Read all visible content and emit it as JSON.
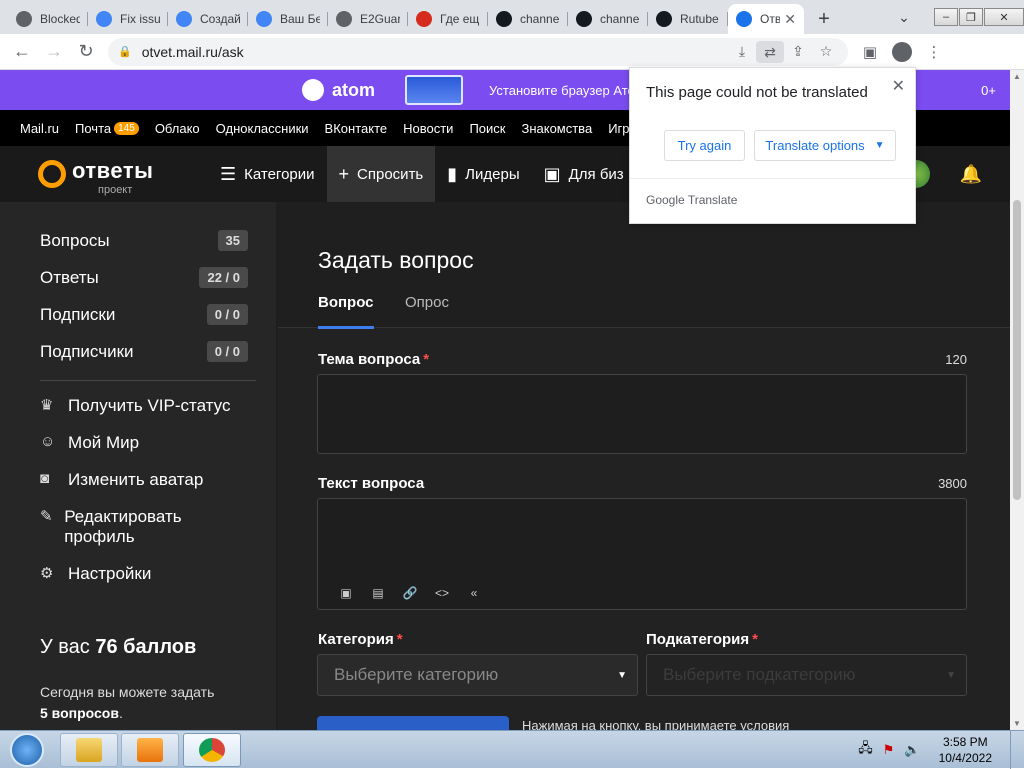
{
  "browser": {
    "tabs": [
      {
        "label": "Blocked",
        "icon": "globe-icon",
        "color": "#5f6368"
      },
      {
        "label": "Fix issu",
        "icon": "google-icon",
        "color": "#4285f4"
      },
      {
        "label": "Создай",
        "icon": "google-icon",
        "color": "#4285f4"
      },
      {
        "label": "Ваш Бе",
        "icon": "google-icon",
        "color": "#4285f4"
      },
      {
        "label": "E2Guar",
        "icon": "globe-icon",
        "color": "#5f6368"
      },
      {
        "label": "Где ещ",
        "icon": "swiss-flag-icon",
        "color": "#d52b1e"
      },
      {
        "label": "channe",
        "icon": "rutube-icon",
        "color": "#14191f"
      },
      {
        "label": "channe",
        "icon": "rutube-icon",
        "color": "#14191f"
      },
      {
        "label": "Rutube",
        "icon": "rutube-icon",
        "color": "#14191f"
      },
      {
        "label": "Отв",
        "icon": "question-icon",
        "color": "#1a73e8",
        "active": true
      }
    ],
    "new_tab": "+",
    "url": "otvet.mail.ru/ask"
  },
  "promo": {
    "brand": "atom",
    "text": "Установите браузер Ато",
    "cut_text": "ть",
    "age": "0+"
  },
  "mailbar": {
    "items": [
      "Mail.ru",
      "Почта",
      "Облако",
      "Одноклассники",
      "ВКонтакте",
      "Новости",
      "Поиск",
      "Знакомства",
      "Игр"
    ],
    "mail_badge": "145"
  },
  "header": {
    "logo": "ответы",
    "logo_sub": "проект",
    "nav": [
      {
        "label": "Категории",
        "icon": "list-icon"
      },
      {
        "label": "Спросить",
        "icon": "plus-icon",
        "active": true
      },
      {
        "label": "Лидеры",
        "icon": "chart-icon"
      },
      {
        "label": "Для биз",
        "icon": "briefcase-icon"
      }
    ]
  },
  "sidebar": {
    "stats": [
      {
        "label": "Вопросы",
        "count": "35"
      },
      {
        "label": "Ответы",
        "count": "22 / 0"
      },
      {
        "label": "Подписки",
        "count": "0 / 0"
      },
      {
        "label": "Подписчики",
        "count": "0 / 0"
      }
    ],
    "links": [
      {
        "label": "Получить VIP-статус",
        "icon": "crown-icon"
      },
      {
        "label": "Мой Мир",
        "icon": "smile-icon"
      },
      {
        "label": "Изменить аватар",
        "icon": "camera-icon"
      },
      {
        "label": "Редактировать профиль",
        "icon": "edit-icon"
      },
      {
        "label": "Настройки",
        "icon": "gear-icon"
      }
    ],
    "score_prefix": "У вас",
    "score_value": "76 баллов",
    "note_line1": "Сегодня вы можете задать",
    "note_line2": "5 вопросов",
    "note_dot": "."
  },
  "form": {
    "title": "Задать вопрос",
    "tabs": [
      "Вопрос",
      "Опрос"
    ],
    "topic_label": "Тема вопроса",
    "topic_count": "120",
    "text_label": "Текст вопроса",
    "text_count": "3800",
    "category_label": "Категория",
    "category_placeholder": "Выберите категорию",
    "subcategory_label": "Подкатегория",
    "subcategory_placeholder": "Выберите подкатегорию",
    "terms": "Нажимая на кнопку, вы принимаете условия"
  },
  "translate_popup": {
    "message": "This page could not be translated",
    "try_again": "Try again",
    "options": "Translate options",
    "footer": "Google Translate"
  },
  "taskbar": {
    "time": "3:58 PM",
    "date": "10/4/2022"
  }
}
